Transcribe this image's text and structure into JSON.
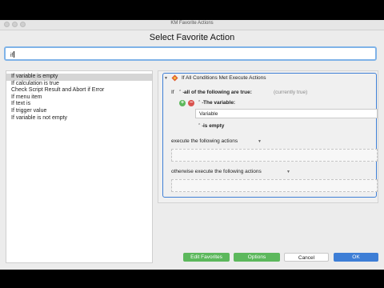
{
  "window": {
    "title": "KM Favorite Actions"
  },
  "heading": "Select Favorite Action",
  "search": {
    "value": "if"
  },
  "list": {
    "items": [
      "If variable is empty",
      "If calculation is true",
      "Check Script Result and Abort if Error",
      "If menu item",
      "If text is",
      "If trigger value",
      "If variable is not empty"
    ],
    "selected_index": 0
  },
  "action": {
    "title": "If All Conditions Met Execute Actions",
    "if_label": "If",
    "condition_mode": "all of the following are true:",
    "currently_status": "(currently true)",
    "add_symbol": "+",
    "remove_symbol": "−",
    "condition_type": "The variable:",
    "variable_value": "Variable",
    "comparison": "is empty",
    "execute_label": "execute the following actions",
    "otherwise_label": "otherwise execute the following actions"
  },
  "icons": {
    "dropdown": "▼",
    "stepper": "⌃⌄"
  },
  "buttons": {
    "edit_favorites": "Edit Favorites",
    "options": "Options",
    "cancel": "Cancel",
    "ok": "OK"
  },
  "colors": {
    "green": "#5cb85c",
    "blue": "#3d7ed6",
    "focus": "#7fb3e8",
    "remove": "#d9534f"
  }
}
